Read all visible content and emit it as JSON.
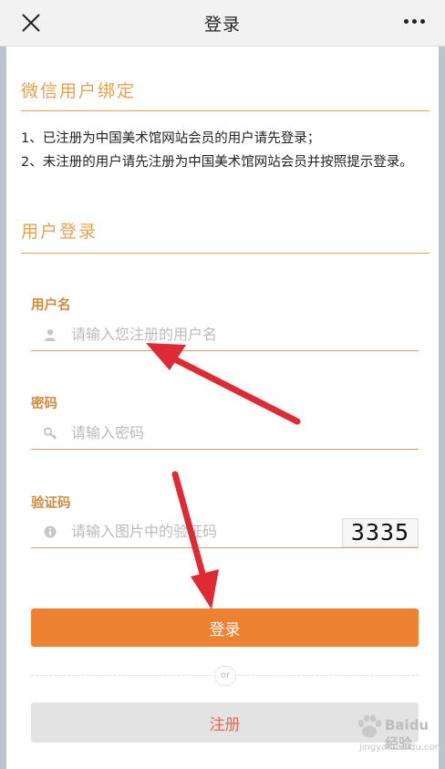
{
  "topbar": {
    "title": "登录"
  },
  "sections": {
    "bind_title": "微信用户绑定",
    "login_title": "用户登录"
  },
  "notice": {
    "line1": "1、已注册为中国美术馆网站会员的用户请先登录；",
    "line2": "2、未注册的用户请先注册为中国美术馆网站会员并按照提示登录。"
  },
  "form": {
    "username": {
      "label": "用户名",
      "placeholder": "请输入您注册的用户名",
      "value": ""
    },
    "password": {
      "label": "密码",
      "placeholder": "请输入密码",
      "value": ""
    },
    "captcha": {
      "label": "验证码",
      "placeholder": "请输入图片中的验证码",
      "value": "",
      "image_text": "3335"
    }
  },
  "buttons": {
    "login": "登录",
    "or": "or",
    "register": "注册"
  },
  "watermark": {
    "text": "Baidu 经验",
    "url": "jingyan.baidu.com"
  },
  "colors": {
    "accent": "#e8a04c",
    "login_button": "#ee8233",
    "register_text": "#e36a5a",
    "annotation_arrow": "#e02a33"
  },
  "icons": {
    "close": "close-icon",
    "more": "more-icon",
    "user": "user-icon",
    "key": "key-icon",
    "info": "info-icon"
  }
}
